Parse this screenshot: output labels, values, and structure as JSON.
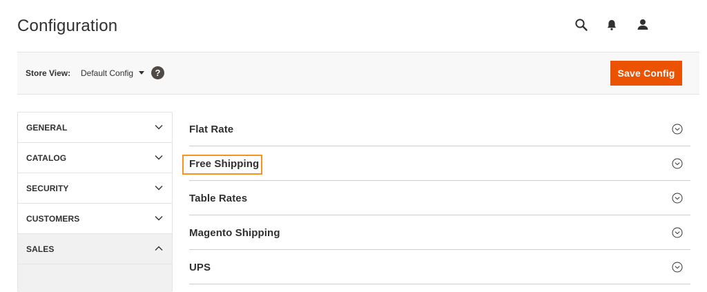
{
  "page": {
    "title": "Configuration"
  },
  "header": {
    "icons": [
      "search-icon",
      "bell-icon",
      "user-icon"
    ]
  },
  "toolbar": {
    "store_view_label": "Store View:",
    "store_view_value": "Default Config",
    "help_icon": "?",
    "save_label": "Save Config"
  },
  "sidebar": {
    "items": [
      {
        "label": "GENERAL",
        "expanded": false
      },
      {
        "label": "CATALOG",
        "expanded": false
      },
      {
        "label": "SECURITY",
        "expanded": false
      },
      {
        "label": "CUSTOMERS",
        "expanded": false
      },
      {
        "label": "SALES",
        "expanded": true
      }
    ]
  },
  "sections": [
    {
      "title": "Flat Rate"
    },
    {
      "title": "Free Shipping",
      "highlighted": true
    },
    {
      "title": "Table Rates"
    },
    {
      "title": "Magento Shipping"
    },
    {
      "title": "UPS"
    }
  ],
  "colors": {
    "accent": "#eb5202",
    "highlight": "#f7941e",
    "text": "#303030",
    "toolbar_bg": "#f8f8f8"
  }
}
